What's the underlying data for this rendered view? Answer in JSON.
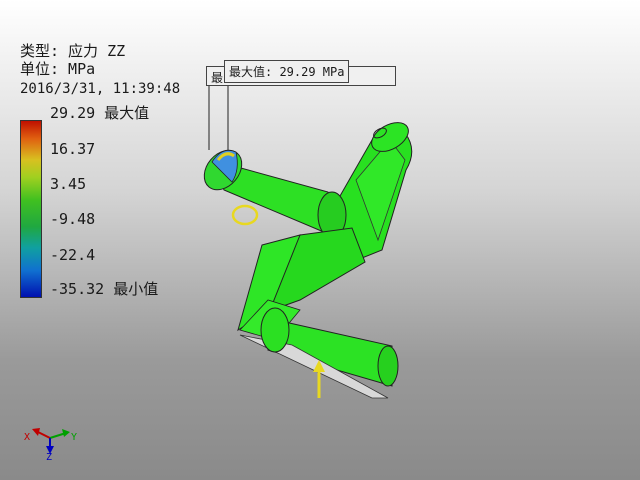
{
  "result_info": {
    "type_line": "类型: 应力 ZZ",
    "unit_line": "单位: MPa",
    "timestamp": "2016/3/31, 11:39:48"
  },
  "legend": {
    "max_label": "29.29 最大值",
    "tick_1": "16.37",
    "tick_2": "3.45",
    "tick_3": "-9.48",
    "tick_4": "-22.4",
    "min_label": "-35.32 最小值",
    "colors": [
      "#c01000",
      "#e06010",
      "#d8c020",
      "#a0d020",
      "#40c020",
      "#20a840",
      "#10a0a0",
      "#1070d0",
      "#0010b0"
    ]
  },
  "callouts": {
    "max_value": "最大值: 29.29 MPa",
    "hidden_label": "最"
  },
  "axes": {
    "x": "X",
    "y": "Y",
    "z": "Z"
  },
  "icons": [
    "view-cube-axes-icon",
    "load-arrow-icon",
    "constraint-icon"
  ]
}
